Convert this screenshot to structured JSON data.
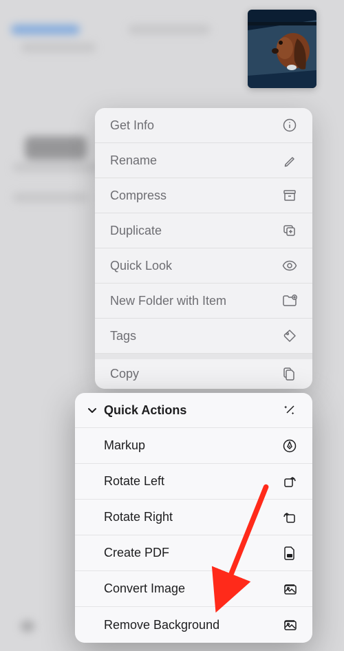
{
  "thumbnail": {
    "description": "dog-looking-out-car-window"
  },
  "context_menu": {
    "items": [
      {
        "label": "Get Info",
        "icon": "info-circle"
      },
      {
        "label": "Rename",
        "icon": "pencil"
      },
      {
        "label": "Compress",
        "icon": "archivebox"
      },
      {
        "label": "Duplicate",
        "icon": "plus-on-square"
      },
      {
        "label": "Quick Look",
        "icon": "eye"
      },
      {
        "label": "New Folder with Item",
        "icon": "folder-plus"
      },
      {
        "label": "Tags",
        "icon": "tag"
      },
      {
        "label": "Copy",
        "icon": "doc-on-doc"
      }
    ]
  },
  "quick_actions": {
    "header": "Quick Actions",
    "items": [
      {
        "label": "Markup",
        "icon": "pen-tip"
      },
      {
        "label": "Rotate Left",
        "icon": "rotate-left"
      },
      {
        "label": "Rotate Right",
        "icon": "rotate-right"
      },
      {
        "label": "Create PDF",
        "icon": "doc-pdf"
      },
      {
        "label": "Convert Image",
        "icon": "photo-stack"
      },
      {
        "label": "Remove Background",
        "icon": "photo-stack"
      }
    ]
  },
  "annotation": {
    "type": "arrow",
    "color": "#ff2a1a",
    "points_to": "remove-background-item"
  }
}
